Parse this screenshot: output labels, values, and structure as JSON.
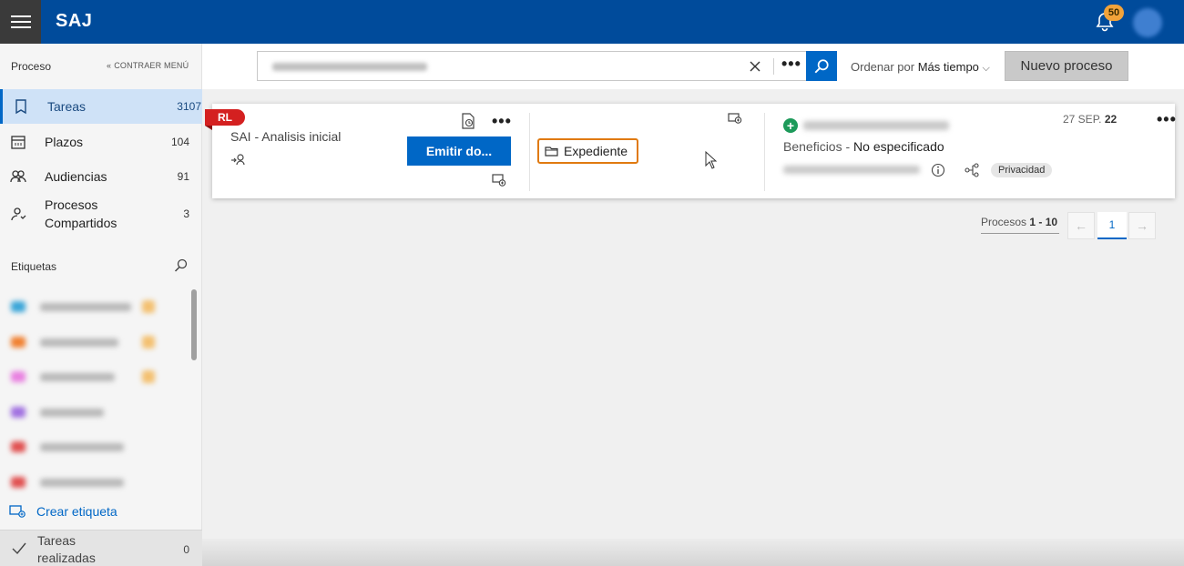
{
  "topbar": {
    "app_title": "SAJ",
    "notifications_count": "50"
  },
  "sidebar": {
    "header": "Proceso",
    "collapse_label": "CONTRAER MENÚ",
    "items": [
      {
        "label": "Tareas",
        "count": "3107",
        "icon": "tasks-icon"
      },
      {
        "label": "Plazos",
        "count": "104",
        "icon": "calendar-icon"
      },
      {
        "label": "Audiencias",
        "count": "91",
        "icon": "people-icon"
      },
      {
        "label": "Procesos Compartidos",
        "count": "3",
        "icon": "shared-user-icon"
      }
    ],
    "tags_title": "Etiquetas",
    "create_tag_label": "Crear etiqueta",
    "done_label": "Tareas realizadas",
    "done_count": "0"
  },
  "toolbar": {
    "sort_prefix": "Ordenar por",
    "sort_value": "Más tiempo",
    "new_process_label": "Nuevo proceso"
  },
  "task_card": {
    "badge": "RL",
    "title": "SAI - Analisis inicial",
    "emit_button": "Emitir do...",
    "expediente_label": "Expediente",
    "date_prefix": "27 SEP.",
    "date_day": "22",
    "benefit_label": "Beneficios",
    "benefit_separator": " - ",
    "benefit_value": "No especificado",
    "privacy_tag": "Privacidad"
  },
  "pagination": {
    "label": "Procesos",
    "range": "1 - 10",
    "current_page": "1"
  },
  "colors": {
    "topbar": "#004b9b",
    "accent": "#0067c6",
    "badge_red": "#d42020",
    "highlight_orange": "#e07a10"
  }
}
